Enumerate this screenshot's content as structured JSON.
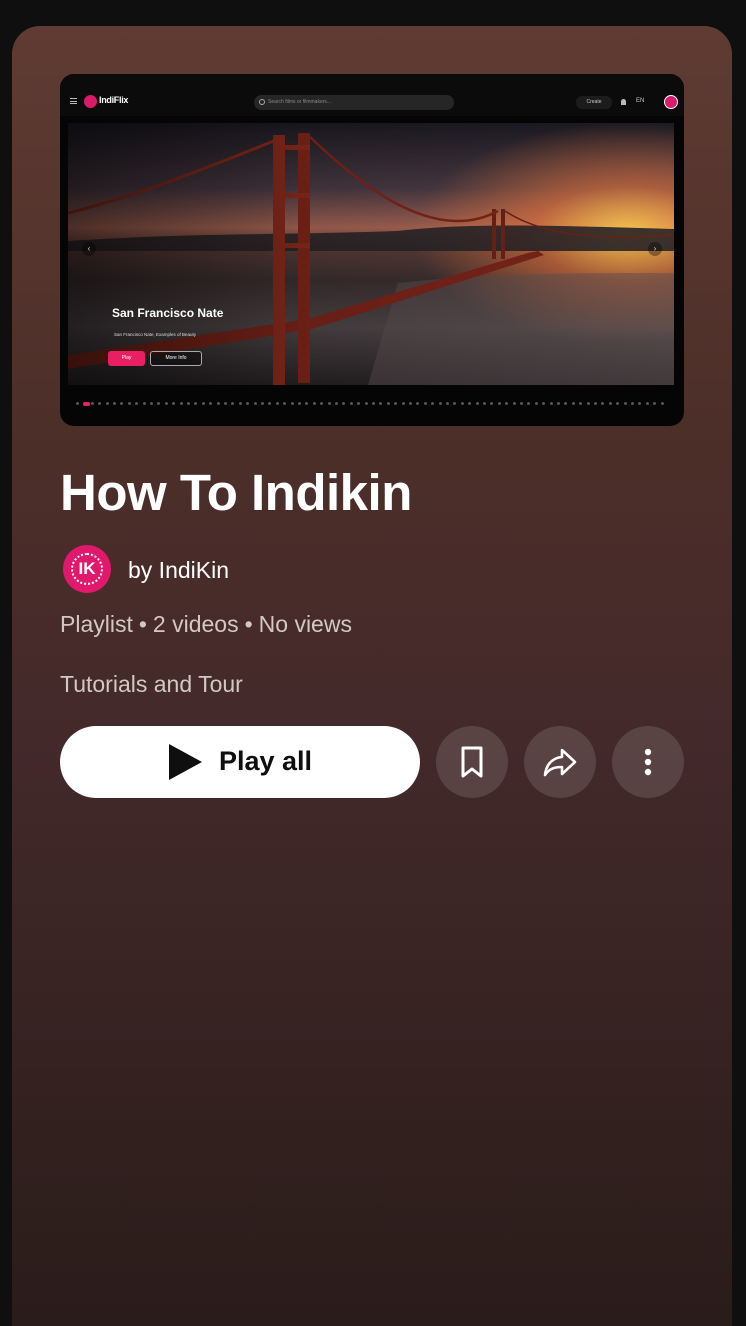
{
  "thumbnail": {
    "app_name": "IndiFlix",
    "search_placeholder": "Search films or filmmakers...",
    "create_label": "Create",
    "language": "EN",
    "hero_title": "San Francisco Nate",
    "hero_subtitle": "San Francisco Nate, Examples of Beauty",
    "play_label": "Play",
    "more_label": "More Info",
    "prev_arrow": "‹",
    "next_arrow": "›"
  },
  "playlist": {
    "title": "How To Indikin",
    "owner": "by IndiKin",
    "avatar_initials": "IK",
    "type": "Playlist",
    "video_count": "2 videos",
    "views": "No views",
    "separator": "•",
    "description": "Tutorials and Tour"
  },
  "actions": {
    "play_all_label": "Play all",
    "save_icon": "bookmark-icon",
    "share_icon": "share-icon",
    "more_icon": "more-vertical-icon"
  },
  "colors": {
    "accent": "#e91e63",
    "avatar": "#e0196c",
    "background": "#0f0f0f"
  }
}
